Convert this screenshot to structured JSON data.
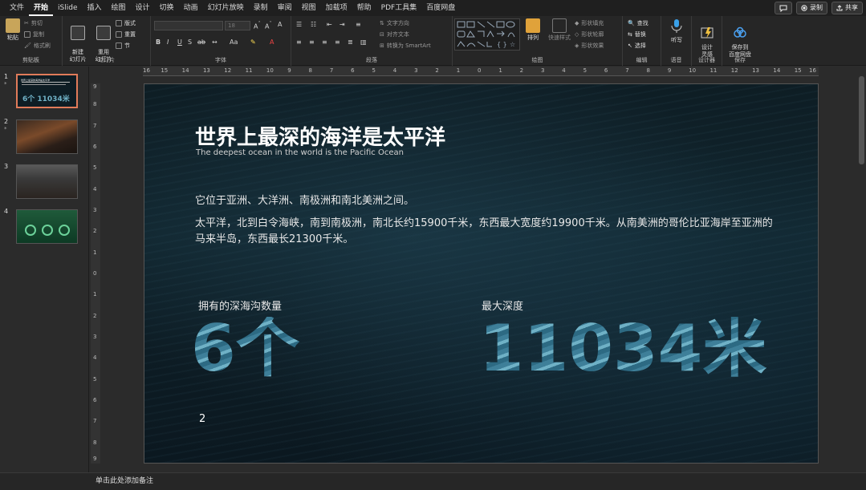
{
  "menubar": {
    "items": [
      "文件",
      "开始",
      "iSlide",
      "插入",
      "绘图",
      "设计",
      "切换",
      "动画",
      "幻灯片放映",
      "录制",
      "审阅",
      "视图",
      "加载项",
      "帮助",
      "PDF工具集",
      "百度网盘"
    ],
    "active": "开始",
    "right_buttons": {
      "comment": "",
      "record": "录制",
      "share": "共享"
    }
  },
  "ribbon": {
    "clipboard": {
      "paste": "粘贴",
      "cut": "剪切",
      "copy": "复制",
      "format": "格式刷",
      "label": "剪贴板"
    },
    "slides": {
      "new": "新建\n幻灯片",
      "reuse": "重用\n幻灯片",
      "layout": "版式",
      "reset": "重置",
      "section": "节",
      "label": "幻灯片"
    },
    "font": {
      "label": "字体",
      "size": "18"
    },
    "paragraph": {
      "label": "段落",
      "text_direction": "文字方向",
      "align_text": "对齐文本",
      "smartart": "转换为 SmartArt"
    },
    "drawing": {
      "arrange": "排列",
      "quick_styles": "快速样式",
      "fill": "形状填充",
      "outline": "形状轮廓",
      "effects": "形状效果",
      "label": "绘图"
    },
    "editing": {
      "find": "查找",
      "replace": "替换",
      "select": "选择",
      "label": "编辑"
    },
    "voice": {
      "dictate": "听写",
      "label": "语音"
    },
    "designer": {
      "ideas": "设计\n灵感",
      "label": "设计器"
    },
    "save": {
      "baidu": "保存到\n百度网盘",
      "label": "保存"
    }
  },
  "thumbnails": [
    {
      "num": "1",
      "star": "*",
      "title": "世界上最深的海洋是太平洋",
      "big": "6个  11034米"
    },
    {
      "num": "2",
      "star": "*"
    },
    {
      "num": "3",
      "star": ""
    },
    {
      "num": "4",
      "star": ""
    }
  ],
  "hruler": [
    "16",
    "15",
    "14",
    "13",
    "12",
    "11",
    "10",
    "9",
    "8",
    "7",
    "6",
    "5",
    "4",
    "3",
    "2",
    "1",
    "0",
    "1",
    "2",
    "3",
    "4",
    "5",
    "6",
    "7",
    "8",
    "9",
    "10",
    "11",
    "12",
    "13",
    "14",
    "15",
    "16"
  ],
  "vruler": [
    "9",
    "8",
    "7",
    "6",
    "5",
    "4",
    "3",
    "2",
    "1",
    "0",
    "1",
    "2",
    "3",
    "4",
    "5",
    "6",
    "7",
    "8",
    "9"
  ],
  "slide": {
    "title": "世界上最深的海洋是太平洋",
    "subtitle": "The deepest ocean in the world is the Pacific Ocean",
    "p1": "它位于亚洲、大洋洲、南极洲和南北美洲之间。",
    "p2": "太平洋，北到白令海峡，南到南极洲，南北长约15900千米，东西最大宽度约19900千米。从南美洲的哥伦比亚海岸至亚洲的马来半岛，东西最长21300千米。",
    "label1": "拥有的深海沟数量",
    "value1": "6个",
    "label2": "最大深度",
    "value2": "11034米",
    "page": "2"
  },
  "notes": {
    "placeholder": "单击此处添加备注"
  },
  "colors": {
    "accent_selected": "#e07b5a",
    "ocean_text": "#4f8ea6"
  }
}
